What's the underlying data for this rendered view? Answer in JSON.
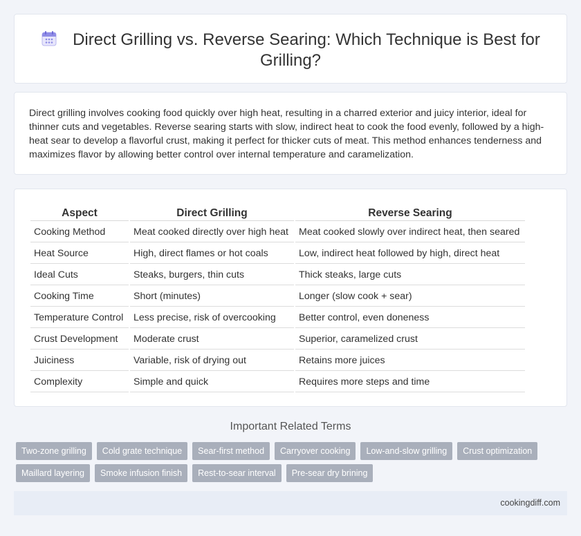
{
  "header": {
    "title": "Direct Grilling vs. Reverse Searing: Which Technique is Best for Grilling?",
    "icon": "calendar-icon",
    "icon_color": "#7b7fe0"
  },
  "intro": {
    "text": "Direct grilling involves cooking food quickly over high heat, resulting in a charred exterior and juicy interior, ideal for thinner cuts and vegetables. Reverse searing starts with slow, indirect heat to cook the food evenly, followed by a high-heat sear to develop a flavorful crust, making it perfect for thicker cuts of meat. This method enhances tenderness and maximizes flavor by allowing better control over internal temperature and caramelization."
  },
  "table": {
    "headers": [
      "Aspect",
      "Direct Grilling",
      "Reverse Searing"
    ],
    "rows": [
      [
        "Cooking Method",
        "Meat cooked directly over high heat",
        "Meat cooked slowly over indirect heat, then seared"
      ],
      [
        "Heat Source",
        "High, direct flames or hot coals",
        "Low, indirect heat followed by high, direct heat"
      ],
      [
        "Ideal Cuts",
        "Steaks, burgers, thin cuts",
        "Thick steaks, large cuts"
      ],
      [
        "Cooking Time",
        "Short (minutes)",
        "Longer (slow cook + sear)"
      ],
      [
        "Temperature Control",
        "Less precise, risk of overcooking",
        "Better control, even doneness"
      ],
      [
        "Crust Development",
        "Moderate crust",
        "Superior, caramelized crust"
      ],
      [
        "Juiciness",
        "Variable, risk of drying out",
        "Retains more juices"
      ],
      [
        "Complexity",
        "Simple and quick",
        "Requires more steps and time"
      ]
    ]
  },
  "related": {
    "title": "Important Related Terms",
    "tags": [
      "Two-zone grilling",
      "Cold grate technique",
      "Sear-first method",
      "Carryover cooking",
      "Low-and-slow grilling",
      "Crust optimization",
      "Maillard layering",
      "Smoke infusion finish",
      "Rest-to-sear interval",
      "Pre-sear dry brining"
    ]
  },
  "footer": {
    "site": "cookingdiff.com"
  }
}
